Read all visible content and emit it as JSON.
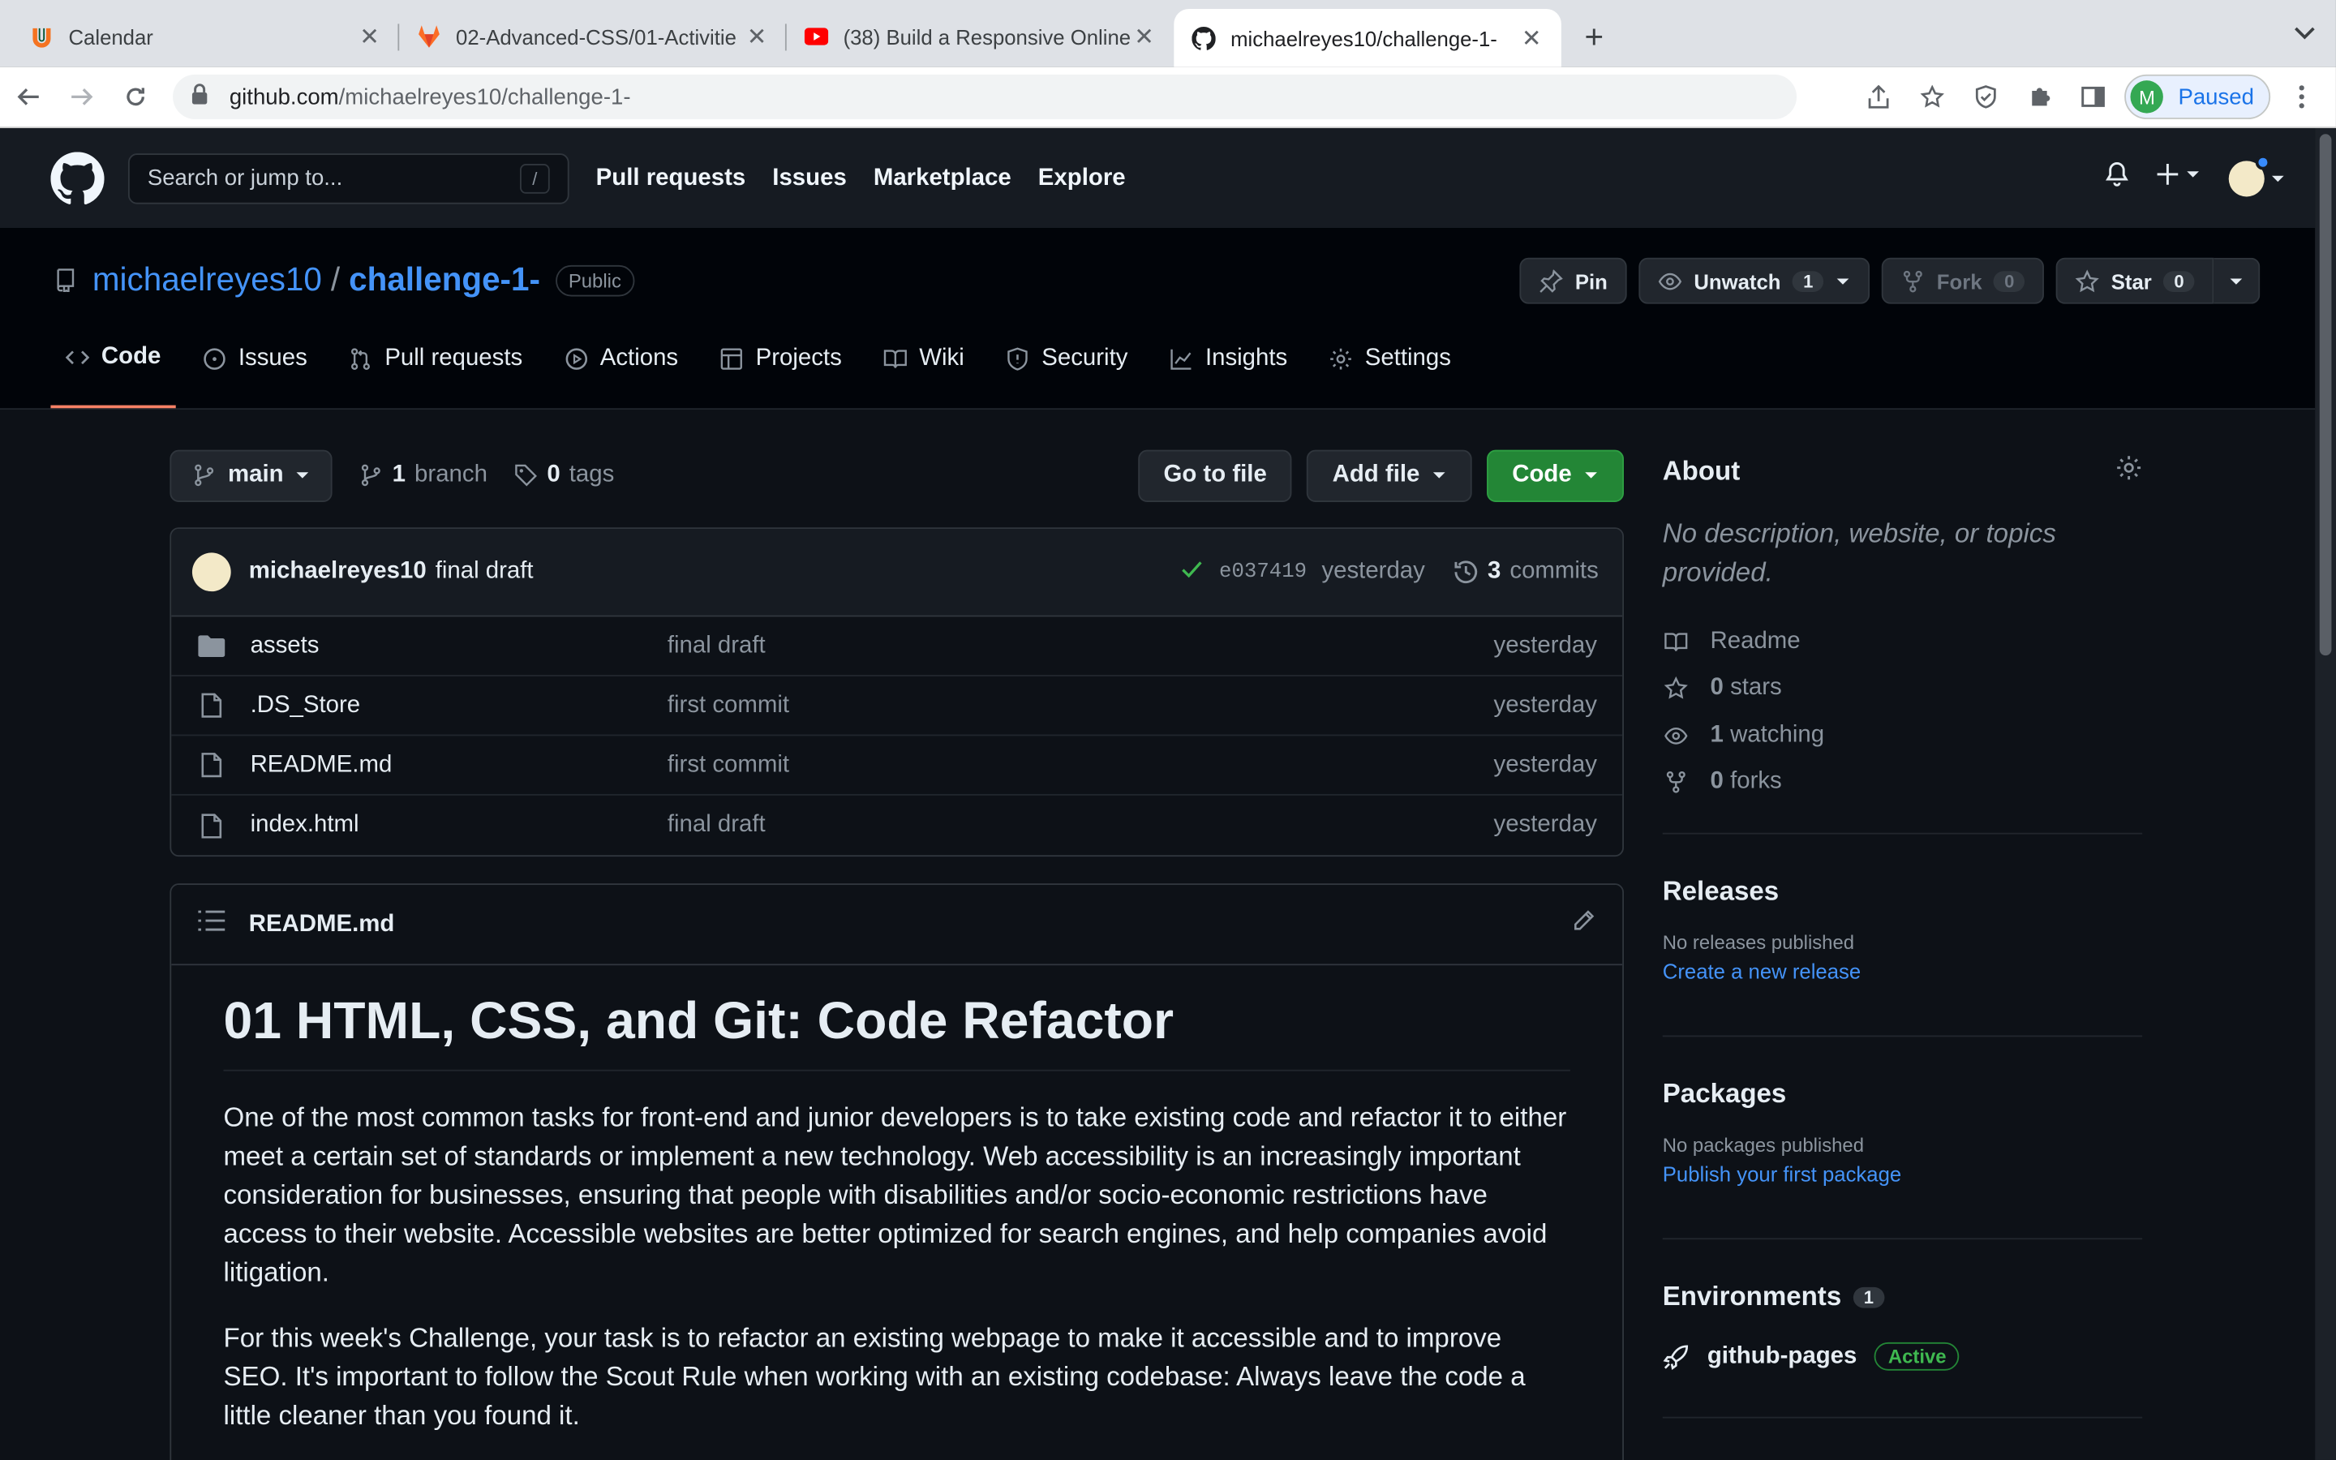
{
  "browser": {
    "tabs": [
      {
        "title": "Calendar",
        "icon": "u-logo-icon"
      },
      {
        "title": "02-Advanced-CSS/01-Activitie",
        "icon": "gitlab-icon"
      },
      {
        "title": "(38) Build a Responsive Online",
        "icon": "youtube-icon"
      },
      {
        "title": "michaelreyes10/challenge-1-",
        "icon": "github-icon"
      }
    ],
    "url_host": "github.com",
    "url_path": "/michaelreyes10/challenge-1-",
    "profile_initial": "M",
    "profile_label": "Paused"
  },
  "gh": {
    "search_placeholder": "Search or jump to...",
    "search_key": "/",
    "nav": [
      "Pull requests",
      "Issues",
      "Marketplace",
      "Explore"
    ]
  },
  "repo": {
    "owner": "michaelreyes10",
    "name": "challenge-1-",
    "visibility": "Public",
    "pin": "Pin",
    "unwatch": "Unwatch",
    "watch_count": "1",
    "fork": "Fork",
    "fork_count": "0",
    "star": "Star",
    "star_count": "0",
    "tabs": [
      "Code",
      "Issues",
      "Pull requests",
      "Actions",
      "Projects",
      "Wiki",
      "Security",
      "Insights",
      "Settings"
    ]
  },
  "toolbar": {
    "branch": "main",
    "branch_count": "1",
    "branch_label": "branch",
    "tag_count": "0",
    "tag_label": "tags",
    "goto": "Go to file",
    "addfile": "Add file",
    "code": "Code"
  },
  "commit": {
    "author": "michaelreyes10",
    "message": "final draft",
    "sha": "e037419",
    "time": "yesterday",
    "count": "3",
    "count_label": "commits"
  },
  "files": [
    {
      "name": "assets",
      "message": "final draft",
      "date": "yesterday",
      "type": "folder"
    },
    {
      "name": ".DS_Store",
      "message": "first commit",
      "date": "yesterday",
      "type": "file"
    },
    {
      "name": "README.md",
      "message": "first commit",
      "date": "yesterday",
      "type": "file"
    },
    {
      "name": "index.html",
      "message": "final draft",
      "date": "yesterday",
      "type": "file"
    }
  ],
  "readme": {
    "filename": "README.md",
    "title": "01 HTML, CSS, and Git: Code Refactor",
    "p1": "One of the most common tasks for front-end and junior developers is to take existing code and refactor it to either meet a certain set of standards or implement a new technology. Web accessibility is an increasingly important consideration for businesses, ensuring that people with disabilities and/or socio-economic restrictions have access to their website. Accessible websites are better optimized for search engines, and help companies avoid litigation.",
    "p2": "For this week's Challenge, your task is to refactor an existing webpage to make it accessible and to improve SEO. It's important to follow the Scout Rule when working with an existing codebase: Always leave the code a little cleaner than you found it."
  },
  "about": {
    "title": "About",
    "description": "No description, website, or topics provided.",
    "readme": "Readme",
    "stars_count": "0",
    "stars_label": "stars",
    "watching_count": "1",
    "watching_label": "watching",
    "forks_count": "0",
    "forks_label": "forks"
  },
  "releases": {
    "title": "Releases",
    "none": "No releases published",
    "link": "Create a new release"
  },
  "packages": {
    "title": "Packages",
    "none": "No packages published",
    "link": "Publish your first package"
  },
  "environments": {
    "title": "Environments",
    "count": "1",
    "name": "github-pages",
    "status": "Active"
  },
  "colors": {
    "accent": "#4493f8",
    "green": "#238636",
    "tab_underline": "#f78166",
    "bg": "#0d1117"
  }
}
